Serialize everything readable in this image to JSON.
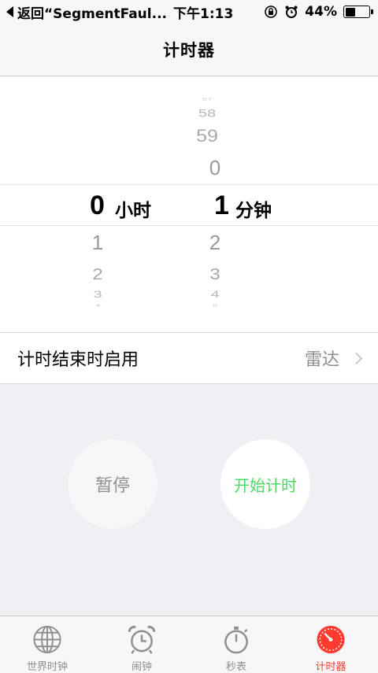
{
  "status_bar": {
    "back_text": "返回“SegmentFaul...",
    "time": "下午1:13",
    "battery": "44%",
    "battery_level": 0.44,
    "icons": [
      "back-arrow-icon",
      "rotation-lock-icon",
      "alarm-icon",
      "battery-icon"
    ]
  },
  "nav": {
    "title": "计时器"
  },
  "picker": {
    "hours_column": {
      "selected": "0",
      "unit": "小时",
      "below": [
        "1",
        "2",
        "3",
        "4"
      ]
    },
    "minutes_column": {
      "above": [
        "57",
        "58",
        "59",
        "0"
      ],
      "selected": "1",
      "unit": "分钟",
      "below": [
        "2",
        "3",
        "4",
        "5"
      ]
    }
  },
  "setting": {
    "label": "计时结束时启用",
    "value": "雷达"
  },
  "buttons": {
    "pause": "暂停",
    "start": "开始计时"
  },
  "tabs": [
    {
      "label": "世界时钟",
      "icon": "globe-icon",
      "active": false
    },
    {
      "label": "闹钟",
      "icon": "alarm-clock-icon",
      "active": false
    },
    {
      "label": "秒表",
      "icon": "stopwatch-icon",
      "active": false
    },
    {
      "label": "计时器",
      "icon": "timer-icon",
      "active": true
    }
  ],
  "colors": {
    "accent": "#ff3b30",
    "start": "#4cd964",
    "inactive": "#8e8e93"
  }
}
